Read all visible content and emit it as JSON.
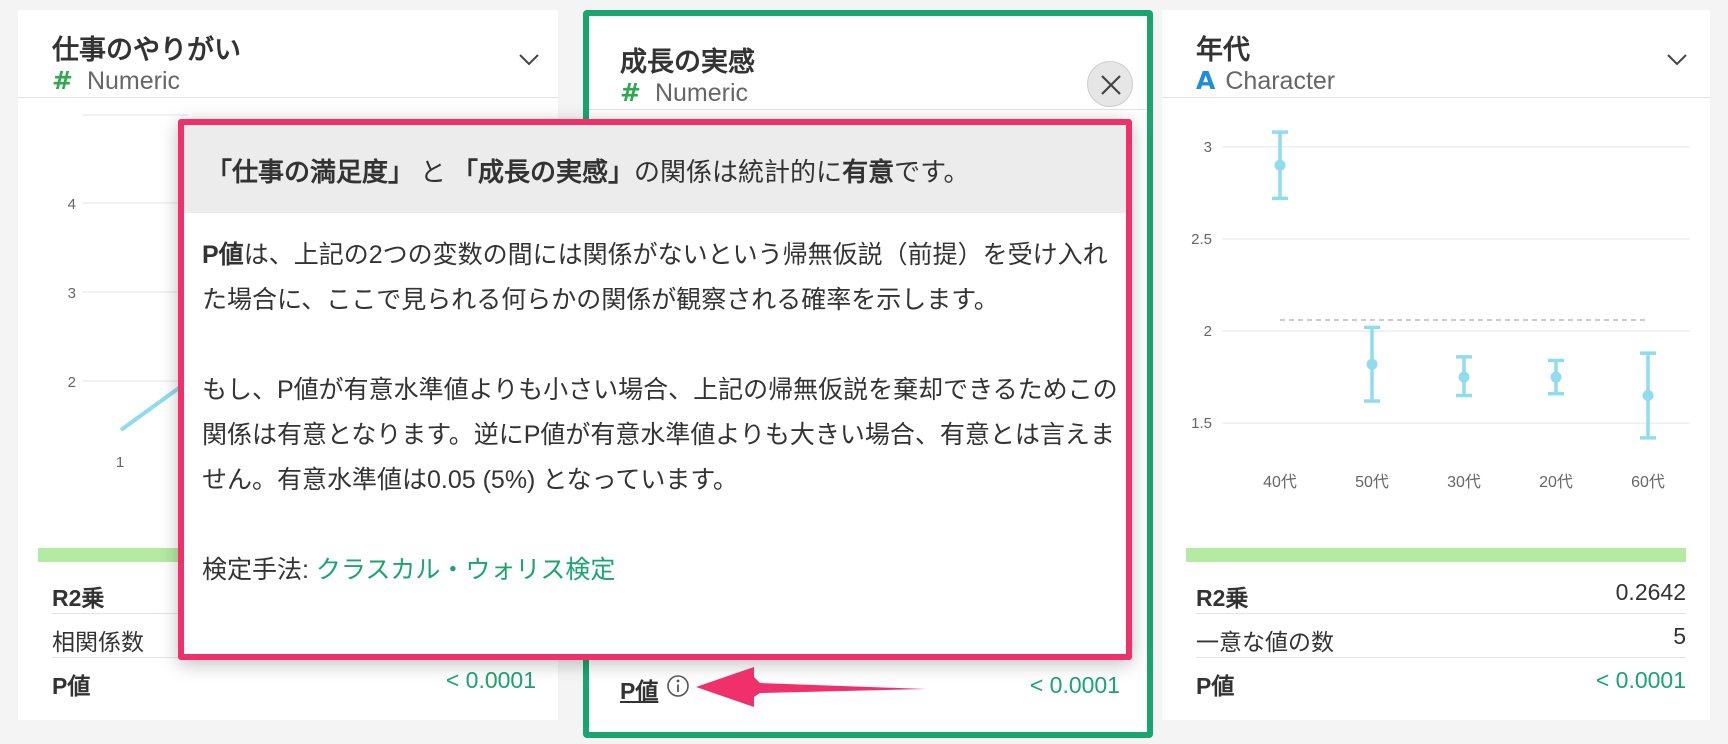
{
  "left_card": {
    "column_name": "仕事のやりがい",
    "type_icon": "#",
    "type_label": "Numeric",
    "y_ticks": [
      "4",
      "3",
      "2"
    ],
    "x_tick": "1",
    "stats": [
      {
        "label": "R2乗",
        "value": ""
      },
      {
        "label": "相関係数",
        "value": ""
      },
      {
        "label": "P値",
        "value": "< 0.0001"
      }
    ]
  },
  "mid_card": {
    "column_name": "成長の実感",
    "type_icon": "#",
    "type_label": "Numeric",
    "p_label": "P値",
    "p_value": "< 0.0001"
  },
  "right_card": {
    "column_name": "年代",
    "type_icon": "A",
    "type_label": "Character",
    "stats": [
      {
        "label": "R2乗",
        "value": "0.2642"
      },
      {
        "label": "一意な値の数",
        "value": "5"
      },
      {
        "label": "P値",
        "value": "< 0.0001"
      }
    ]
  },
  "chart_data": {
    "type": "scatter",
    "categories": [
      "40代",
      "50代",
      "30代",
      "20代",
      "60代"
    ],
    "series": [
      {
        "values": [
          2.9,
          1.82,
          1.75,
          1.75,
          1.65
        ],
        "lower": [
          2.72,
          1.62,
          1.65,
          1.66,
          1.42
        ],
        "upper": [
          3.08,
          2.02,
          1.86,
          1.84,
          1.88
        ]
      }
    ],
    "y_ticks": [
      "3",
      "2.5",
      "2",
      "1.5"
    ],
    "ylim": [
      1.3,
      3.2
    ],
    "reference_line": 2.06,
    "grid": true
  },
  "popup": {
    "title_var1": "「仕事の満足度」",
    "title_to": "と",
    "title_var2": "「成長の実感」",
    "title_mid": "の関係は統計的に",
    "title_sig": "有意",
    "title_end": "です。",
    "p_term": "P値",
    "para1": "は、上記の2つの変数の間には関係がないという帰無仮説（前提）を受け入れた場合に、ここで見られる何らかの関係が観察される確率を示します。",
    "para2": "もし、P値が有意水準値よりも小さい場合、上記の帰無仮説を棄却できるためこの関係は有意となります。逆にP値が有意水準値よりも大きい場合、有意とは言えません。有意水準値は0.05 (5%) となっています。",
    "method_label": "検定手法: ",
    "method_link": "クラスカル・ウォリス検定"
  },
  "colors": {
    "accent_green": "#1aa56e",
    "highlight_pink": "#f0306a",
    "chart_blue": "#8fdcef",
    "bar_green": "#b4eaa2"
  }
}
